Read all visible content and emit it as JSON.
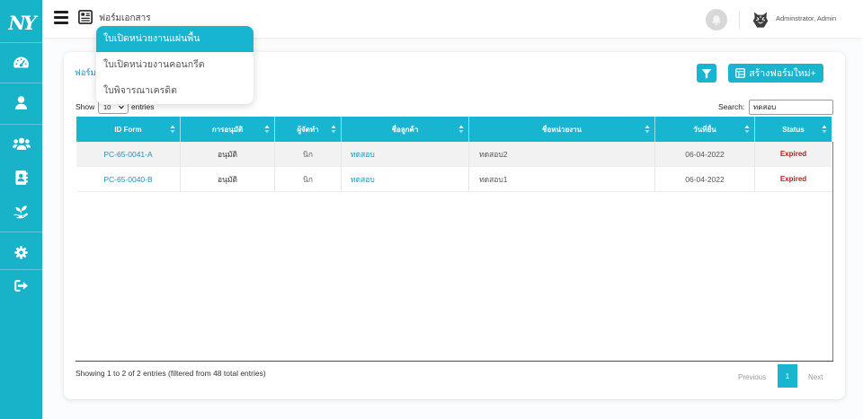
{
  "app": {
    "logo_text": "NY"
  },
  "colors": {
    "sidebar": "#19b3c9",
    "primary": "#17b5d0",
    "link": "#1e93b6",
    "status_expired": "#b71c1c"
  },
  "sidebar": {
    "items": [
      {
        "icon": "dashboard-icon"
      },
      {
        "icon": "user-icon"
      },
      {
        "icon": "users-icon"
      },
      {
        "icon": "address-book-icon"
      },
      {
        "icon": "seedling-icon"
      },
      {
        "icon": "gear-icon"
      },
      {
        "icon": "sign-out-icon"
      }
    ]
  },
  "header": {
    "menu_icon": "hamburger-icon",
    "section_icon": "document-icon",
    "menu_title": "ฟอร์มเอกสาร",
    "notification_icon": "bell-icon",
    "user_name": "Adminstrator, Admin"
  },
  "dropdown": {
    "items": [
      {
        "label": "ใบเปิดหน่วยงานแผ่นพื้น",
        "active": true
      },
      {
        "label": "ใบเปิดหน่วยงานคอนกรีต",
        "active": false
      },
      {
        "label": "ใบพิจารณาเครดิต",
        "active": false
      }
    ]
  },
  "card": {
    "title": "ฟอร์มใ",
    "filter_icon": "filter-icon",
    "create_icon": "table-icon",
    "create_button_label": "สร้างฟอร์มใหม่+"
  },
  "table_controls": {
    "show_label": "Show",
    "page_length": "10",
    "entries_label": "entries",
    "search_label": "Search:",
    "search_value": "ทดสอบ"
  },
  "table": {
    "columns": [
      "ID Form",
      "การอนุมัติ",
      "ผู้จัดทำ",
      "ชื่อลูกค้า",
      "ชื่อหน่วยงาน",
      "วันที่ยื่น",
      "Status"
    ],
    "rows": [
      {
        "id_form": "PC-65-0041-A",
        "approval": "อนุมัติ",
        "creator": "นิก",
        "customer": "ทดสอบ",
        "unit": "ทดสอบ2",
        "date": "06-04-2022",
        "status": "Expired"
      },
      {
        "id_form": "PC-65-0040-B",
        "approval": "อนุมัติ",
        "creator": "นิก",
        "customer": "ทดสอบ",
        "unit": "ทดสอบ1",
        "date": "06-04-2022",
        "status": "Expired"
      }
    ]
  },
  "pagination": {
    "info": "Showing 1 to 2 of 2 entries (filtered from 48 total entries)",
    "previous": "Previous",
    "current_page": "1",
    "next": "Next"
  }
}
